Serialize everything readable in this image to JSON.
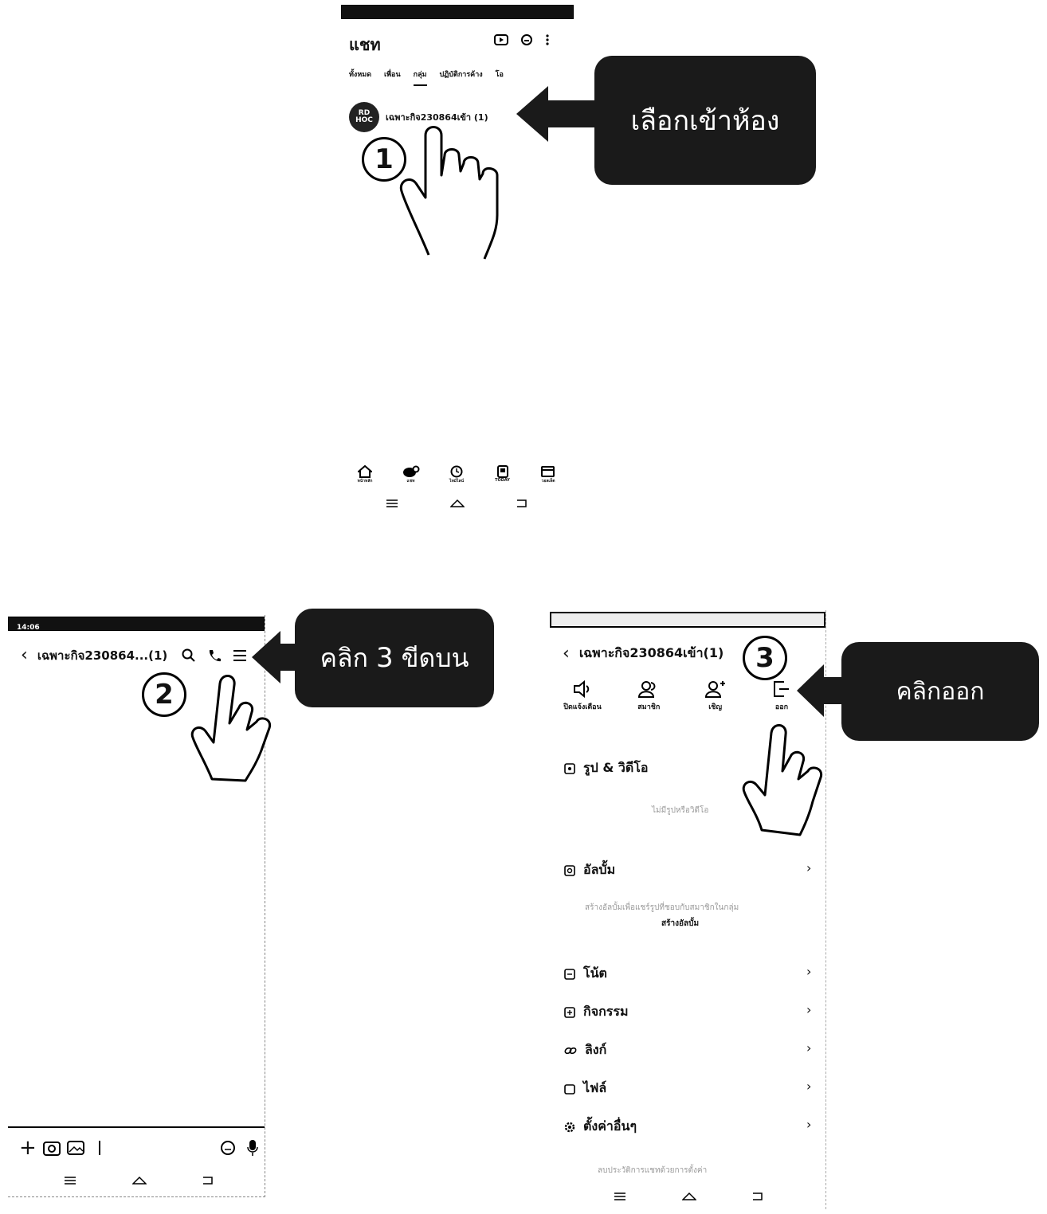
{
  "panel1": {
    "header_title": "แชท",
    "tabs": [
      "ทั้งหมด",
      "เพื่อน",
      "กลุ่ม",
      "ปฏิบัติการค้าง",
      "โอ"
    ],
    "chat_item": {
      "avatar_text": "RD HOC",
      "name": "เฉพาะกิจ230864เข้า (1)"
    },
    "bottom_nav": [
      "หน้าหลัก",
      "แชท",
      "ไทม์ไลน์",
      "TODAY",
      "วอลเล็ต"
    ],
    "callout": "เลือกเข้าห้อง",
    "step": "1"
  },
  "panel2": {
    "status_left": "14:06",
    "title": "เฉพาะกิจ230864...(1)",
    "callout_prefix": "คลิก",
    "callout_number": "3",
    "callout_suffix": "ขีดบน",
    "step": "2"
  },
  "panel3": {
    "title": "เฉพาะกิจ230864เข้า(1)",
    "actions": [
      "ปิดแจ้งเตือน",
      "สมาชิก",
      "เชิญ",
      "ออก"
    ],
    "section_media": "รูป & วิดีโอ",
    "media_empty": "ไม่มีรูปหรือวิดีโอ",
    "section_album": "อัลบั้ม",
    "album_empty": "สร้างอัลบั้มเพื่อแชร์รูปที่ชอบกับสมาชิกในกลุ่ม",
    "album_create": "สร้างอัลบั้ม",
    "menu": [
      "โน้ต",
      "กิจกรรม",
      "ลิงก์",
      "ไฟล์",
      "ตั้งค่าอื่นๆ"
    ],
    "footer": "ลบประวัติการแชทด้วยการตั้งค่า",
    "callout": "คลิกออก",
    "step": "3"
  },
  "colors": {
    "callout_bg": "#1a1a1a",
    "text": "#111111",
    "accent": "#000000"
  }
}
